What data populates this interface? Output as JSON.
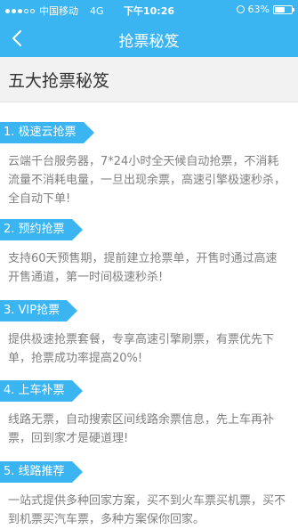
{
  "status_bar": {
    "carrier": "中国移动",
    "network": "4G",
    "time": "下午10:26",
    "battery": "63%",
    "battery_level": 0.63
  },
  "nav": {
    "title": "抢票秘笈"
  },
  "page": {
    "heading": "五大抢票秘笈"
  },
  "sections": [
    {
      "tag": "1. 极速云抢票",
      "text": "云端千台服务器，7*24小时全天候自动抢票，不消耗流量不消耗电量，一旦出现余票，高速引擎极速秒杀，全自动下单!"
    },
    {
      "tag": "2. 预约抢票",
      "text": "支持60天预售期，提前建立抢票单，开售时通过高速开售通道，第一时间极速秒杀!"
    },
    {
      "tag": "3. VIP抢票",
      "text": "提供极速抢票套餐，专享高速引擎刷票，有票优先下单，抢票成功率提高20%!"
    },
    {
      "tag": "4. 上车补票",
      "text": "线路无票，自动搜索区间线路余票信息，先上车再补票，回到家才是硬道理!"
    },
    {
      "tag": "5. 线路推荐",
      "text": "一站式提供多种回家方案，买不到火车票买机票，买不到机票买汽车票，多种方案保你回家。"
    }
  ],
  "colors": {
    "accent": "#3bb4f2",
    "body_text": "#808080",
    "heading_bg": "#f2f2f2"
  }
}
